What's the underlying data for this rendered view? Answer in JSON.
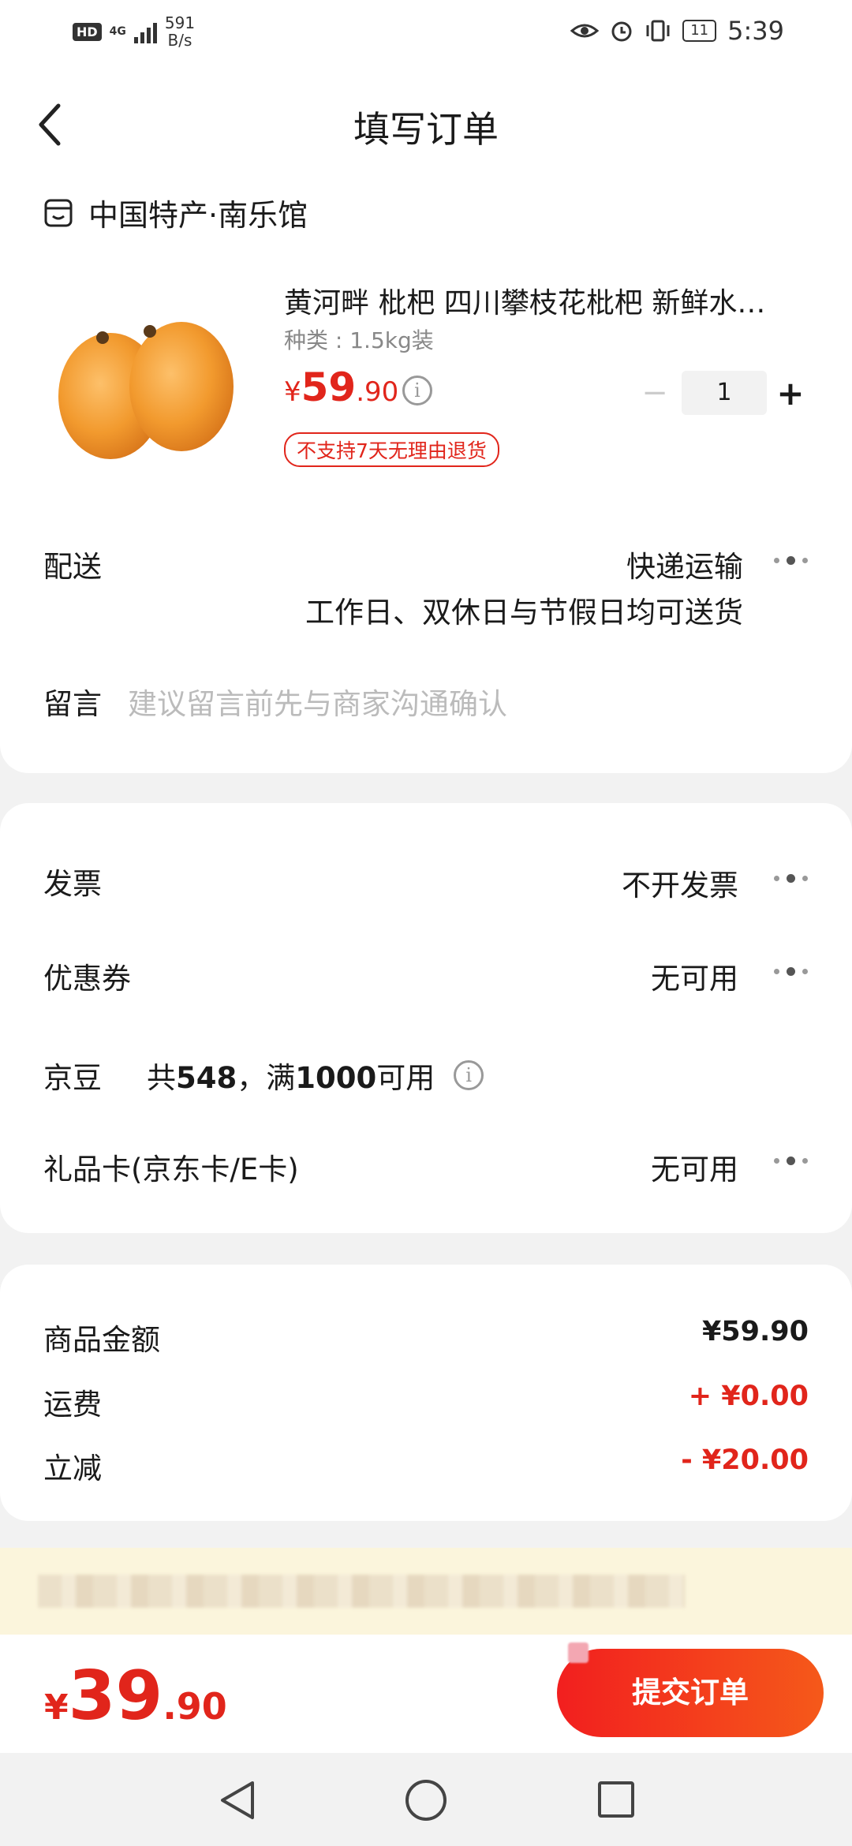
{
  "status_bar": {
    "hd": "HD",
    "network_type": "4G",
    "speed_value": "591",
    "speed_unit": "B/s",
    "battery": "11",
    "time": "5:39"
  },
  "header": {
    "title": "填写订单"
  },
  "store": {
    "name": "中国特产·南乐馆"
  },
  "product": {
    "title": "黄河畔 枇杷 四川攀枝花枇杷 新鲜水…",
    "spec": "种类 : 1.5kg装",
    "price_symbol": "¥",
    "price_int": "59",
    "price_dec": ".90",
    "tag": "不支持7天无理由退货",
    "quantity": "1"
  },
  "delivery": {
    "label": "配送",
    "method": "快递运输",
    "note": "工作日、双休日与节假日均可送货"
  },
  "remark": {
    "label": "留言",
    "placeholder": "建议留言前先与商家沟通确认"
  },
  "invoice": {
    "label": "发票",
    "value": "不开发票"
  },
  "coupon": {
    "label": "优惠券",
    "value": "无可用"
  },
  "beans": {
    "label": "京豆",
    "text_prefix": "共",
    "count": "548",
    "text_mid": "，满",
    "threshold": "1000",
    "text_suffix": "可用"
  },
  "giftcard": {
    "label": "礼品卡(京东卡/E卡)",
    "value": "无可用"
  },
  "summary": {
    "goods_label": "商品金额",
    "goods_value": "¥59.90",
    "shipping_label": "运费",
    "shipping_value": "+ ¥0.00",
    "discount_label": "立减",
    "discount_value": "- ¥20.00"
  },
  "footer": {
    "total_symbol": "¥",
    "total_int": "39",
    "total_dec": ".90",
    "submit_label": "提交订单"
  },
  "colors": {
    "accent": "#e1251b",
    "banner_bg": "#fbf5dc"
  }
}
